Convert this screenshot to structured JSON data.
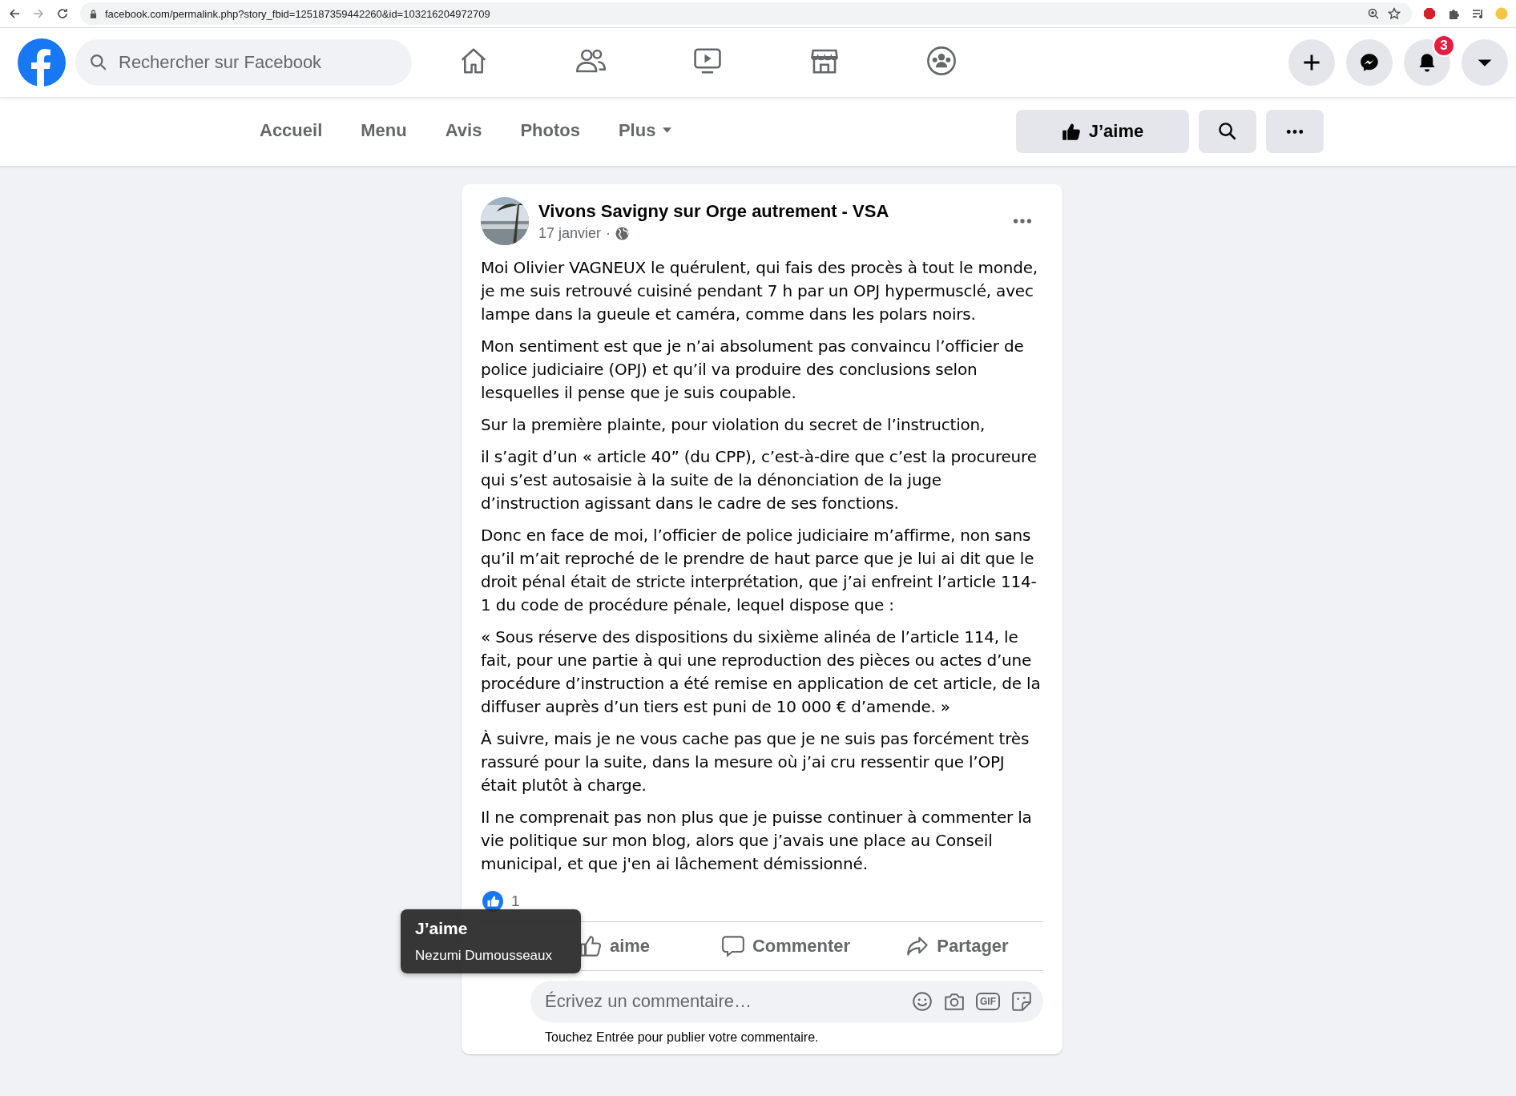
{
  "browser": {
    "url": "facebook.com/permalink.php?story_fbid=125187359442260&id=103216204972709"
  },
  "header": {
    "search_placeholder": "Rechercher sur Facebook",
    "nav": [
      {
        "kind": "home",
        "selected": false
      },
      {
        "kind": "friends",
        "selected": false
      },
      {
        "kind": "video",
        "selected": false
      },
      {
        "kind": "marketplace",
        "selected": false
      },
      {
        "kind": "groups",
        "selected": false
      }
    ],
    "notification_count": "3"
  },
  "page_nav": {
    "tabs": [
      {
        "label": "Accueil",
        "selected": false
      },
      {
        "label": "Menu",
        "selected": false
      },
      {
        "label": "Avis",
        "selected": false
      },
      {
        "label": "Photos",
        "selected": false
      },
      {
        "label": "Plus",
        "selected": false
      }
    ],
    "like_button": "J’aime"
  },
  "post": {
    "author": "Vivons Savigny sur Orge autrement - VSA",
    "date": "17 janvier",
    "separator": "·",
    "paragraphs": [
      "Moi Olivier VAGNEUX le quérulent, qui fais des procès à tout le monde, je me suis retrouvé cuisiné pendant 7 h par un OPJ hypermusclé, avec lampe dans la gueule et caméra, comme dans les polars noirs.",
      "Mon sentiment est que je n’ai absolument pas convaincu l’officier de police judiciaire (OPJ) et qu’il va produire des conclusions selon lesquelles il pense que je suis coupable.",
      "Sur la première plainte, pour violation du secret de l’instruction,",
      "il s’agit d’un « article 40” (du CPP), c’est-à-dire que c’est la procureure qui s’est autosaisie à la suite de la dénonciation de la juge d’instruction agissant dans le cadre de ses fonctions.",
      "Donc en face de moi, l’officier de police judiciaire m’affirme, non sans qu’il m’ait reproché de le prendre de haut parce que je lui ai dit que le droit pénal était de stricte interprétation, que j’ai enfreint l’article 114-1 du code de procédure pénale, lequel dispose que :",
      "« Sous réserve des dispositions du sixième alinéa de l’article 114, le fait, pour une partie à qui une reproduction des pièces ou actes d’une procédure d’instruction a été remise en application de cet article, de la diffuser auprès d’un tiers est puni de 10 000 € d’amende. »",
      "À suivre, mais je ne vous cache pas que je ne suis pas forcément très rassuré pour la suite, dans la mesure où j’ai cru ressentir que l’OPJ était plutôt à charge.",
      "Il ne comprenait pas non plus que je puisse continuer à commenter la vie politique sur mon blog, alors que j’avais une place au Conseil municipal, et que j'en ai lâchement démissionné."
    ],
    "reaction_count": "1",
    "actions": [
      {
        "kind": "like",
        "label": "aime"
      },
      {
        "kind": "comment",
        "label": "Commenter"
      },
      {
        "kind": "share",
        "label": "Partager"
      }
    ],
    "comment_placeholder": "Écrivez un commentaire…",
    "gif_label": "GIF",
    "comment_hint": "Touchez Entrée pour publier votre commentaire."
  },
  "tooltip": {
    "title": "J’aime",
    "name": "Nezumi Dumousseaux"
  }
}
